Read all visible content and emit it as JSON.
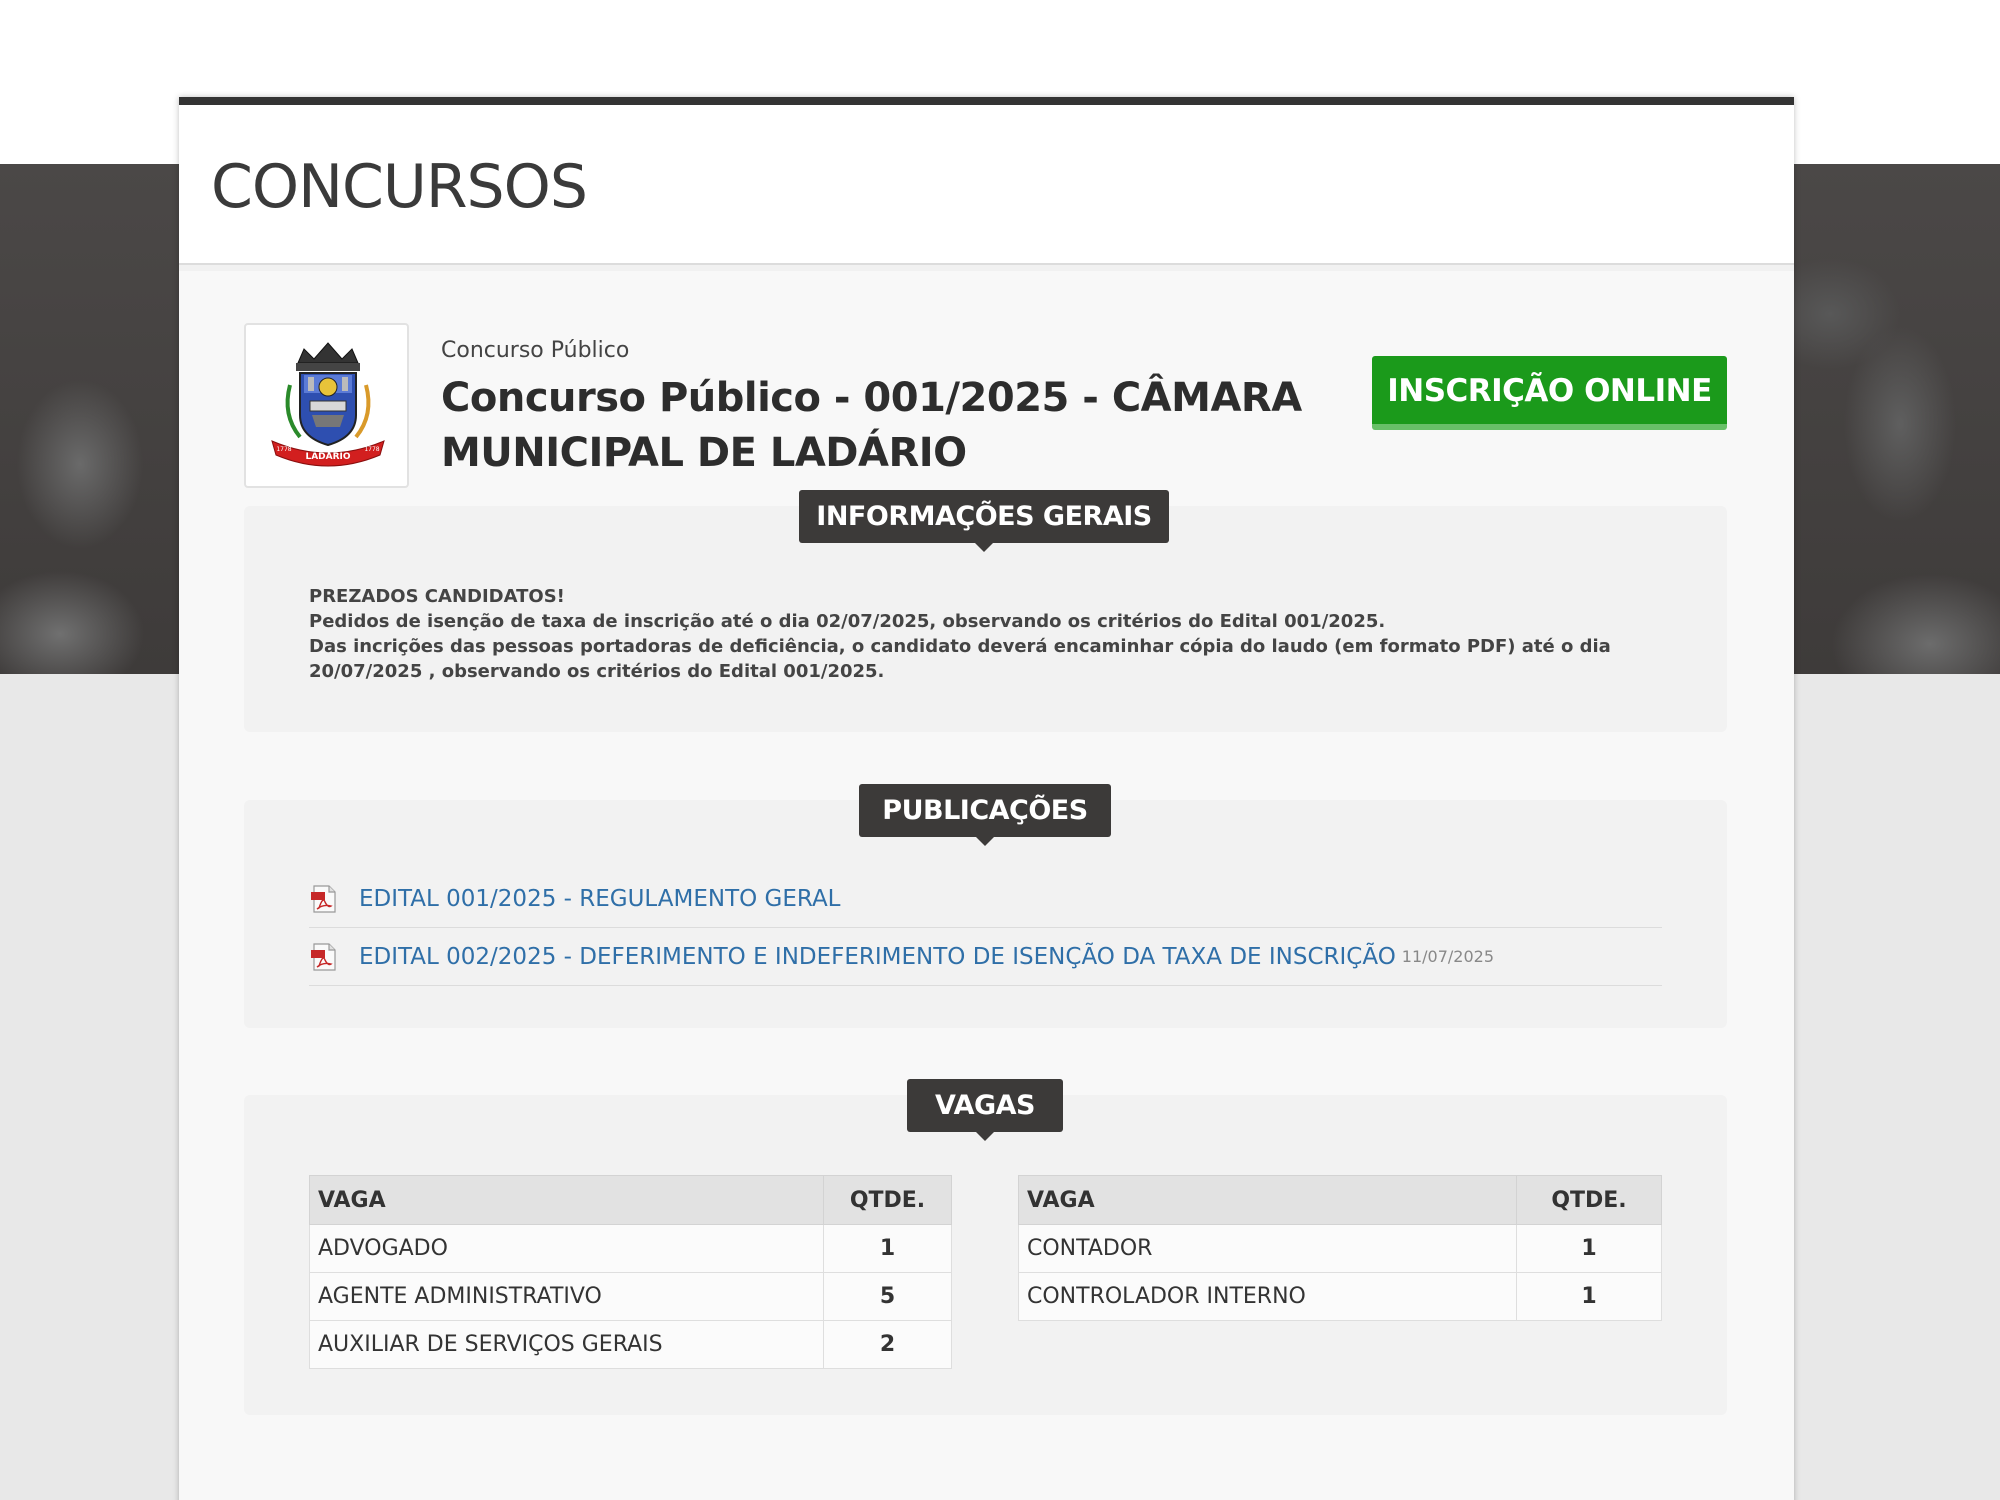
{
  "page": {
    "title": "CONCURSOS"
  },
  "contest": {
    "category": "Concurso Público",
    "title": "Concurso Público - 001/2025 - CÂMARA MUNICIPAL DE LADÁRIO",
    "logo_text": "LADÁRIO",
    "logo_left": "1778",
    "logo_right": "1778",
    "register_button": "INSCRIÇÃO ONLINE"
  },
  "info": {
    "heading": "INFORMAÇÕES GERAIS",
    "lines": [
      "PREZADOS CANDIDATOS!",
      "Pedidos de isenção de taxa de inscrição até o dia 02/07/2025, observando os critérios do Edital 001/2025.",
      "Das incrições das pessoas portadoras de deficiência, o candidato deverá encaminhar cópia do laudo (em formato PDF) até o dia 20/07/2025 , observando os critérios do Edital 001/2025."
    ]
  },
  "publications": {
    "heading": "PUBLICAÇÕES",
    "items": [
      {
        "label": "EDITAL 001/2025 - REGULAMENTO GERAL",
        "date": ""
      },
      {
        "label": "EDITAL 002/2025 - DEFERIMENTO E INDEFERIMENTO DE ISENÇÃO DA TAXA DE INSCRIÇÃO",
        "date": "11/07/2025"
      }
    ]
  },
  "vagas": {
    "heading": "VAGAS",
    "col_vaga": "VAGA",
    "col_qtde": "QTDE.",
    "left": [
      {
        "name": "ADVOGADO",
        "qty": "1"
      },
      {
        "name": "AGENTE ADMINISTRATIVO",
        "qty": "5"
      },
      {
        "name": "AUXILIAR DE SERVIÇOS GERAIS",
        "qty": "2"
      }
    ],
    "right": [
      {
        "name": "CONTADOR",
        "qty": "1"
      },
      {
        "name": "CONTROLADOR INTERNO",
        "qty": "1"
      }
    ]
  },
  "colors": {
    "accent_green": "#1b9a1b",
    "link_blue": "#2f6fa8",
    "tab_dark": "#3c3a39"
  }
}
